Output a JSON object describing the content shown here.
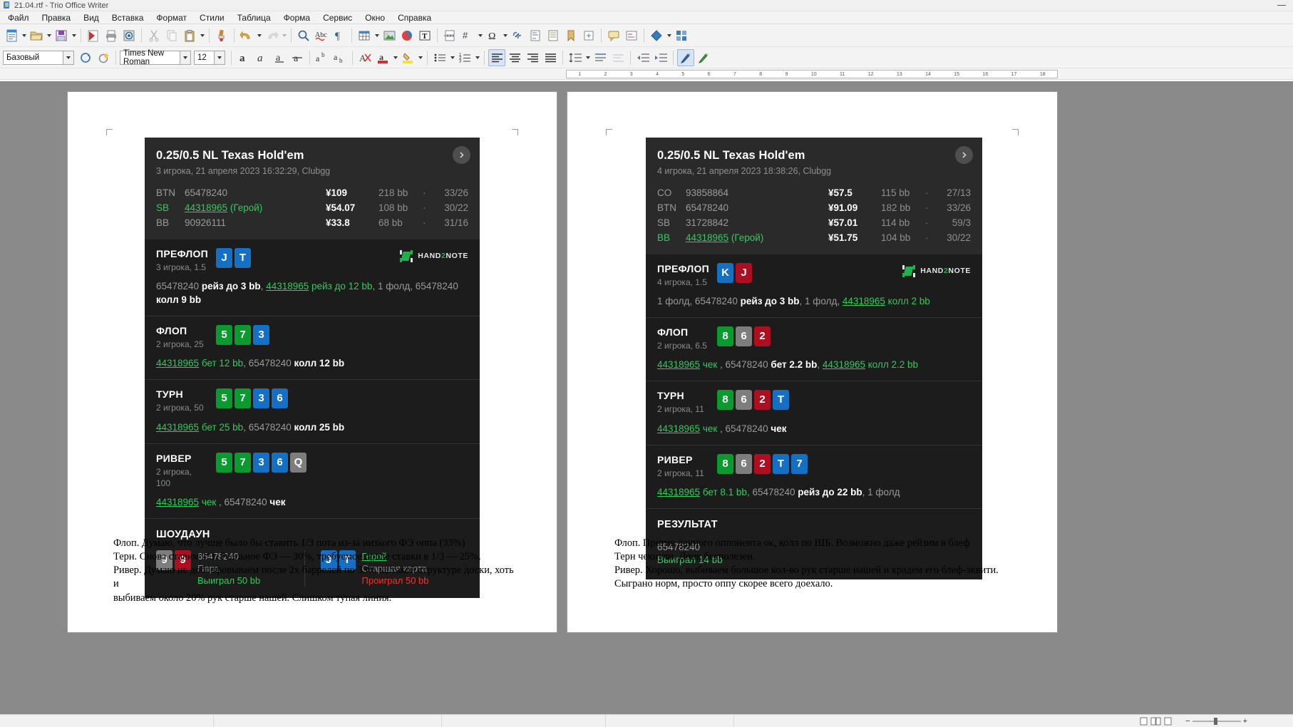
{
  "window": {
    "title": "21.04.rtf - Trio Office Writer",
    "minimize_label": "—"
  },
  "menu": {
    "items": [
      "Файл",
      "Правка",
      "Вид",
      "Вставка",
      "Формат",
      "Стили",
      "Таблица",
      "Форма",
      "Сервис",
      "Окно",
      "Справка"
    ]
  },
  "formatbar": {
    "style": "Базовый",
    "font": "Times New Roman",
    "size": "12"
  },
  "ruler": {
    "left_marks": [
      "1",
      "2",
      "3",
      "4",
      "5",
      "6",
      "7",
      "8",
      "9",
      "10",
      "11",
      "12",
      "13",
      "14",
      "15",
      "16",
      "17"
    ],
    "right_marks": [
      "1",
      "2",
      "3",
      "4",
      "5",
      "6",
      "7",
      "8",
      "9",
      "10",
      "11",
      "12",
      "13",
      "14",
      "15",
      "16",
      "17",
      "18"
    ]
  },
  "colors": {
    "hero_green": "#2ecc5c",
    "card_clubs": "#0b9a2f",
    "card_diamonds": "#1570c4",
    "card_hearts": "#ad0f20",
    "card_spades": "#7d7d7d",
    "loss_red": "#f0332e",
    "panel_bg": "#1c1c1c",
    "header_bg": "#2a2a2a"
  },
  "hand_left": {
    "title": "0.25/0.5 NL Texas Hold'em",
    "subtitle": "3 игрока, 21 апреля 2023 16:32:29, Clubgg",
    "next_icon": "chevron-right-icon",
    "players": [
      {
        "pos": "BTN",
        "name": "65478240",
        "hero": "",
        "stack": "¥109",
        "bb": "218 bb",
        "sep": "·",
        "vpip": "33/26",
        "is_hero": false
      },
      {
        "pos": "SB",
        "name": "44318965",
        "hero": " (Герой)",
        "stack": "¥54.07",
        "bb": "108 bb",
        "sep": "·",
        "vpip": "30/22",
        "is_hero": true
      },
      {
        "pos": "BB",
        "name": "90926111",
        "hero": "",
        "stack": "¥33.8",
        "bb": "68 bb",
        "sep": "·",
        "vpip": "31/16",
        "is_hero": false
      }
    ],
    "brand": {
      "text_a": "HAND",
      "text_b": "2",
      "text_c": "NOTE",
      "icon": "hand2note-logo-icon"
    },
    "streets": [
      {
        "name": "ПРЕФЛОП",
        "info": "3 игрока, 1.5",
        "cards": [
          {
            "r": "J",
            "s": "d"
          },
          {
            "r": "T",
            "s": "d"
          }
        ],
        "show_brand": true,
        "action_parts": [
          {
            "t": "65478240 ",
            "c": "plain"
          },
          {
            "t": "рейз до 3 bb",
            "c": "act"
          },
          {
            "t": ", ",
            "c": "plain"
          },
          {
            "t": "44318965",
            "c": "hero-u"
          },
          {
            "t": " рейз до 12 bb",
            "c": "hero"
          },
          {
            "t": ", 1 фолд, 65478240 ",
            "c": "plain"
          },
          {
            "t": "колл 9 bb",
            "c": "act"
          }
        ]
      },
      {
        "name": "ФЛОП",
        "info": "2 игрока, 25",
        "cards": [
          {
            "r": "5",
            "s": "c"
          },
          {
            "r": "7",
            "s": "c"
          },
          {
            "r": "3",
            "s": "d"
          }
        ],
        "show_brand": false,
        "action_parts": [
          {
            "t": "44318965",
            "c": "hero-u"
          },
          {
            "t": " бет 12 bb",
            "c": "hero"
          },
          {
            "t": ", 65478240 ",
            "c": "plain"
          },
          {
            "t": "колл 12 bb",
            "c": "act"
          }
        ]
      },
      {
        "name": "ТУРН",
        "info": "2 игрока, 50",
        "cards": [
          {
            "r": "5",
            "s": "c"
          },
          {
            "r": "7",
            "s": "c"
          },
          {
            "r": "3",
            "s": "d"
          },
          {
            "r": "6",
            "s": "d"
          }
        ],
        "show_brand": false,
        "action_parts": [
          {
            "t": "44318965",
            "c": "hero-u"
          },
          {
            "t": " бет 25 bb",
            "c": "hero"
          },
          {
            "t": ", 65478240 ",
            "c": "plain"
          },
          {
            "t": "колл 25 bb",
            "c": "act"
          }
        ]
      },
      {
        "name": "РИВЕР",
        "info": "2 игрока, 100",
        "cards": [
          {
            "r": "5",
            "s": "c"
          },
          {
            "r": "7",
            "s": "c"
          },
          {
            "r": "3",
            "s": "d"
          },
          {
            "r": "6",
            "s": "d"
          },
          {
            "r": "Q",
            "s": "s"
          }
        ],
        "show_brand": false,
        "action_parts": [
          {
            "t": "44318965",
            "c": "hero-u"
          },
          {
            "t": " чек",
            "c": "hero"
          },
          {
            "t": " , 65478240 ",
            "c": "plain"
          },
          {
            "t": "чек",
            "c": "act"
          }
        ]
      }
    ],
    "showdown": {
      "title": "ШОУДАУН",
      "entries": [
        {
          "cards": [
            {
              "r": "9",
              "s": "s"
            },
            {
              "r": "9",
              "s": "h"
            }
          ],
          "name": "65478240",
          "is_hero": false,
          "combo": "Пара",
          "outcome": "Выиграл 50 bb",
          "won": true
        },
        {
          "cards": [
            {
              "r": "J",
              "s": "d"
            },
            {
              "r": "T",
              "s": "d"
            }
          ],
          "name": "Герой",
          "is_hero": true,
          "combo": "Старшая карта",
          "outcome": "Проиграл 50 bb",
          "won": false
        }
      ]
    },
    "notes": [
      "Флоп. Думаю, что лучше было бы ставить 1/3 пота из-за низкого ФЭ оппа (33%)",
      "Терн. Снова ставим 1/3. Реальное ФЭ — 30%, требуемое после ставки в 1/3 — 25%.",
      "Ривер. Думаю не доблефовываем после 2х баррелей по 33% на такой структуре доски, хоть и",
      "выбиваем около 20% рук старше нашей. Слишком тупая линия."
    ]
  },
  "hand_right": {
    "title": "0.25/0.5 NL Texas Hold'em",
    "subtitle": "4 игрока, 21 апреля 2023 18:38:26, Clubgg",
    "next_icon": "chevron-right-icon",
    "players": [
      {
        "pos": "CO",
        "name": "93858864",
        "hero": "",
        "stack": "¥57.5",
        "bb": "115 bb",
        "sep": "·",
        "vpip": "27/13",
        "is_hero": false
      },
      {
        "pos": "BTN",
        "name": "65478240",
        "hero": "",
        "stack": "¥91.09",
        "bb": "182 bb",
        "sep": "·",
        "vpip": "33/26",
        "is_hero": false
      },
      {
        "pos": "SB",
        "name": "31728842",
        "hero": "",
        "stack": "¥57.01",
        "bb": "114 bb",
        "sep": "·",
        "vpip": "59/3",
        "is_hero": false
      },
      {
        "pos": "BB",
        "name": "44318965",
        "hero": " (Герой)",
        "stack": "¥51.75",
        "bb": "104 bb",
        "sep": "·",
        "vpip": "30/22",
        "is_hero": true
      }
    ],
    "brand": {
      "text_a": "HAND",
      "text_b": "2",
      "text_c": "NOTE",
      "icon": "hand2note-logo-icon"
    },
    "streets": [
      {
        "name": "ПРЕФЛОП",
        "info": "4 игрока, 1.5",
        "cards": [
          {
            "r": "K",
            "s": "d"
          },
          {
            "r": "J",
            "s": "h"
          }
        ],
        "show_brand": true,
        "action_parts": [
          {
            "t": "1 фолд, 65478240 ",
            "c": "plain"
          },
          {
            "t": "рейз до 3 bb",
            "c": "act"
          },
          {
            "t": ", 1 фолд, ",
            "c": "plain"
          },
          {
            "t": "44318965",
            "c": "hero-u"
          },
          {
            "t": " колл 2 bb",
            "c": "hero"
          }
        ]
      },
      {
        "name": "ФЛОП",
        "info": "2 игрока, 6.5",
        "cards": [
          {
            "r": "8",
            "s": "c"
          },
          {
            "r": "6",
            "s": "s"
          },
          {
            "r": "2",
            "s": "h"
          }
        ],
        "show_brand": false,
        "action_parts": [
          {
            "t": "44318965",
            "c": "hero-u"
          },
          {
            "t": " чек",
            "c": "hero"
          },
          {
            "t": " , 65478240 ",
            "c": "plain"
          },
          {
            "t": "бет 2.2 bb",
            "c": "act"
          },
          {
            "t": ", ",
            "c": "plain"
          },
          {
            "t": "44318965",
            "c": "hero-u"
          },
          {
            "t": " колл 2.2 bb",
            "c": "hero"
          }
        ]
      },
      {
        "name": "ТУРН",
        "info": "2 игрока, 11",
        "cards": [
          {
            "r": "8",
            "s": "c"
          },
          {
            "r": "6",
            "s": "s"
          },
          {
            "r": "2",
            "s": "h"
          },
          {
            "r": "T",
            "s": "d"
          }
        ],
        "show_brand": false,
        "action_parts": [
          {
            "t": "44318965",
            "c": "hero-u"
          },
          {
            "t": " чек",
            "c": "hero"
          },
          {
            "t": " , 65478240 ",
            "c": "plain"
          },
          {
            "t": "чек",
            "c": "act"
          }
        ]
      },
      {
        "name": "РИВЕР",
        "info": "2 игрока, 11",
        "cards": [
          {
            "r": "8",
            "s": "c"
          },
          {
            "r": "6",
            "s": "s"
          },
          {
            "r": "2",
            "s": "h"
          },
          {
            "r": "T",
            "s": "d"
          },
          {
            "r": "7",
            "s": "d"
          }
        ],
        "show_brand": false,
        "action_parts": [
          {
            "t": "44318965",
            "c": "hero-u"
          },
          {
            "t": " бет 8.1 bb",
            "c": "hero"
          },
          {
            "t": ", 65478240 ",
            "c": "plain"
          },
          {
            "t": "рейз до 22 bb",
            "c": "act"
          },
          {
            "t": ", 1 фолд",
            "c": "plain"
          }
        ]
      }
    ],
    "result": {
      "title": "РЕЗУЛЬТАТ",
      "name": "65478240",
      "outcome": "Выиграл 14 bb"
    },
    "notes": [
      "Флоп. Против данного оппонента ок, колл по ШБ. Возможно даже рейзим в блеф",
      "Терн чекнули. Донк бесполезен.",
      "Ривер. Хорошо, выбиваем большое кол-во рук старше нашей и крадем его блеф-эквити.",
      "Сыграно норм, просто оппу скорее всего доехало."
    ]
  },
  "statusbar": {
    "cells": [
      "",
      "",
      "",
      "",
      ""
    ],
    "zoom": ""
  }
}
